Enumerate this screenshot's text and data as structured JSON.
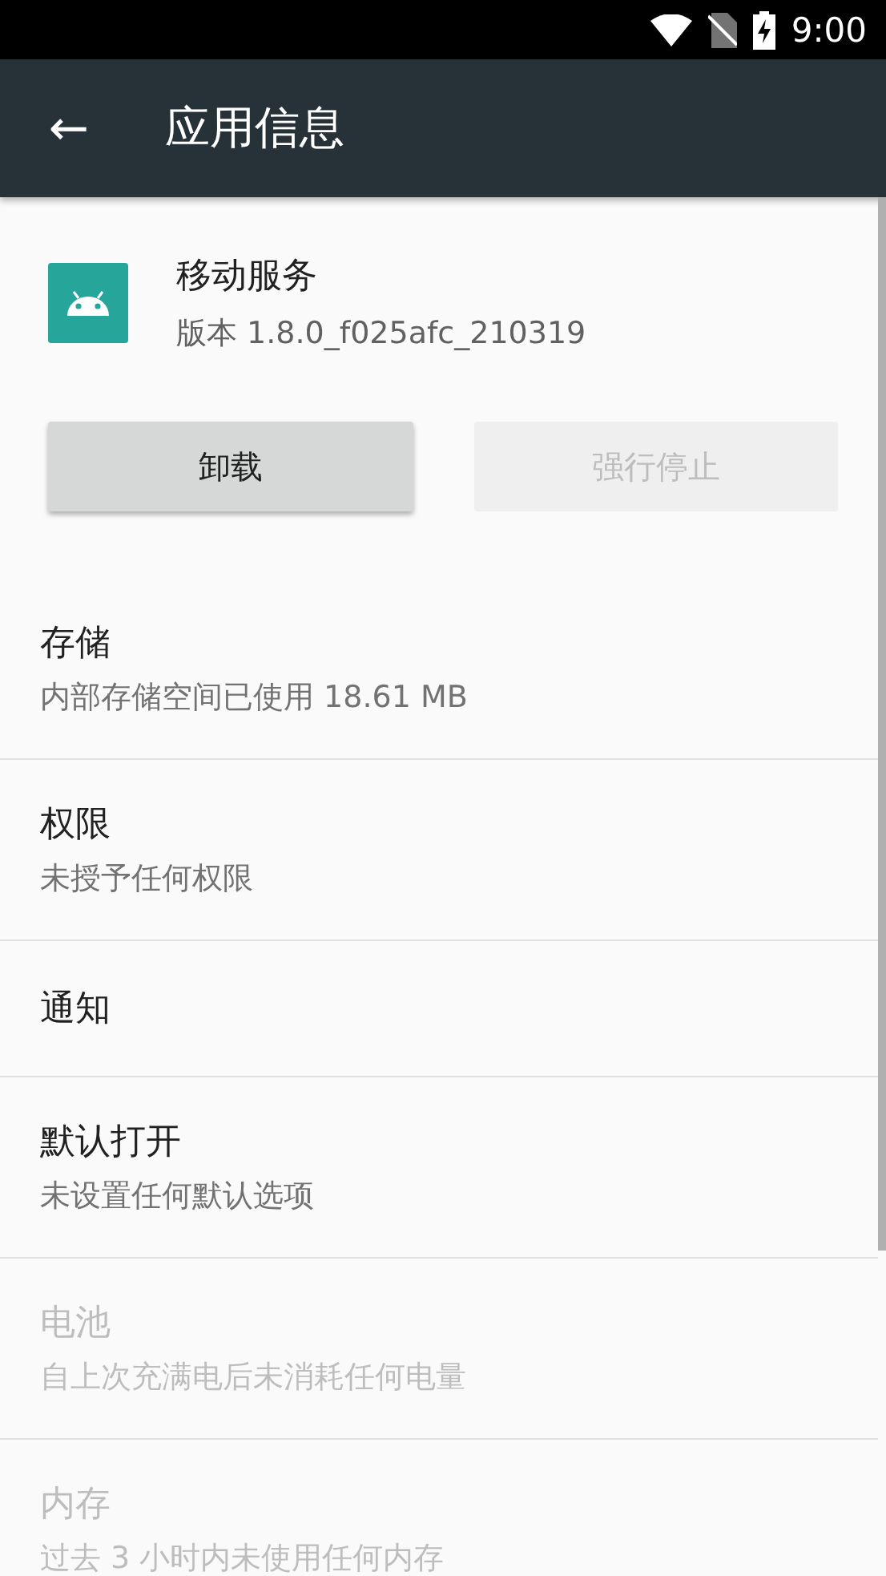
{
  "status_bar": {
    "time": "9:00"
  },
  "toolbar": {
    "back_icon": "←",
    "title": "应用信息"
  },
  "app": {
    "name": "移动服务",
    "version": "版本 1.8.0_f025afc_210319"
  },
  "buttons": [
    {
      "label": "卸载",
      "disabled": false
    },
    {
      "label": "强行停止",
      "disabled": true
    }
  ],
  "items": [
    {
      "title": "存储",
      "subtitle": "内部存储空间已使用 18.61 MB",
      "disabled": false
    },
    {
      "title": "权限",
      "subtitle": "未授予任何权限",
      "disabled": false
    },
    {
      "title": "通知",
      "disabled": false
    },
    {
      "title": "默认打开",
      "subtitle": "未设置任何默认选项",
      "disabled": false
    },
    {
      "title": "电池",
      "subtitle": "自上次充满电后未消耗任何电量",
      "disabled": true
    },
    {
      "title": "内存",
      "subtitle": "过去 3 小时内未使用任何内存",
      "disabled": true
    }
  ]
}
